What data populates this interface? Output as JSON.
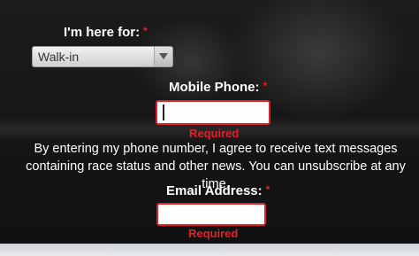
{
  "visit": {
    "label": "I'm here for:",
    "required_mark": "*",
    "selected": "Walk-in"
  },
  "phone": {
    "label": "Mobile Phone:",
    "required_mark": "*",
    "value": "",
    "error": "Required"
  },
  "consent": {
    "text": "By entering my phone number, I agree to receive text messages containing race status and other news. You can unsubscribe at any time."
  },
  "email": {
    "label": "Email Address:",
    "required_mark": "*",
    "value": "",
    "error": "Required"
  },
  "colors": {
    "required": "#e0202a",
    "text": "#ffffff"
  },
  "icons": {
    "select_arrow": "chevron-down-icon"
  }
}
